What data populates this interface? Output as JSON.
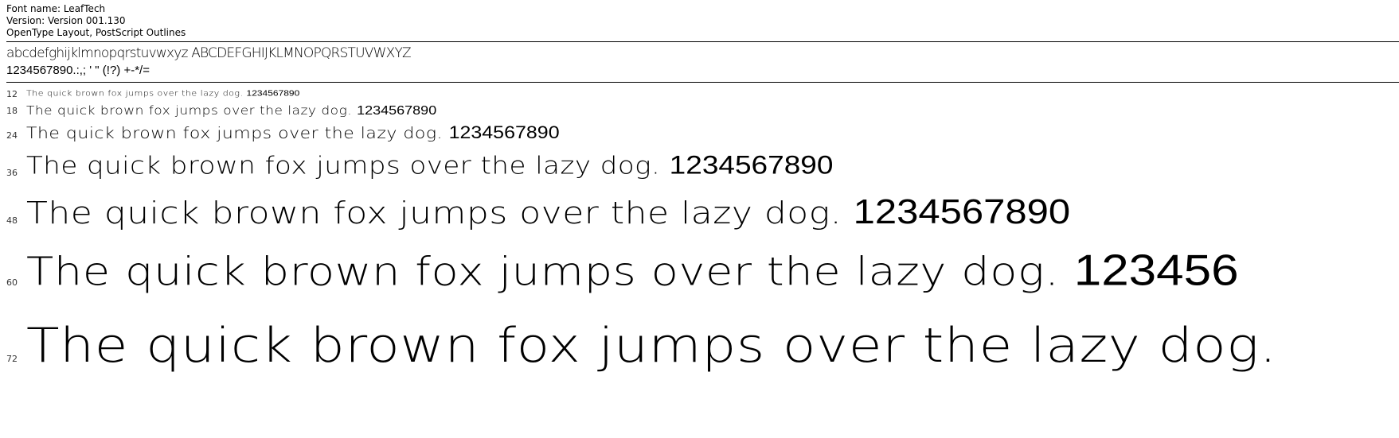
{
  "font_info": {
    "name_line": "Font name: LeafTech",
    "version_line": "Version: Version 001.130",
    "format_line": "OpenType Layout, PostScript Outlines"
  },
  "charset": {
    "letters": "abcdefghijklmnopqrstuvwxyz ABCDEFGHIJKLMNOPQRSTUVWXYZ",
    "digits_symbols": "1234567890.:,; ' \" (!?) +-*/="
  },
  "samples": [
    {
      "size": "12",
      "text": "The quick brown fox jumps over the lazy dog.",
      "digits": "1234567890"
    },
    {
      "size": "18",
      "text": "The quick brown fox jumps over the lazy dog.",
      "digits": "1234567890"
    },
    {
      "size": "24",
      "text": "The quick brown fox jumps over the lazy dog.",
      "digits": "1234567890"
    },
    {
      "size": "36",
      "text": "The quick brown fox jumps over the lazy dog.",
      "digits": "1234567890"
    },
    {
      "size": "48",
      "text": "The quick brown fox jumps over the lazy dog.",
      "digits": "1234567890"
    },
    {
      "size": "60",
      "text": "The quick brown fox jumps over the lazy dog.",
      "digits": "123456"
    },
    {
      "size": "72",
      "text": "The quick brown fox jumps over the lazy dog.",
      "digits": ""
    }
  ]
}
